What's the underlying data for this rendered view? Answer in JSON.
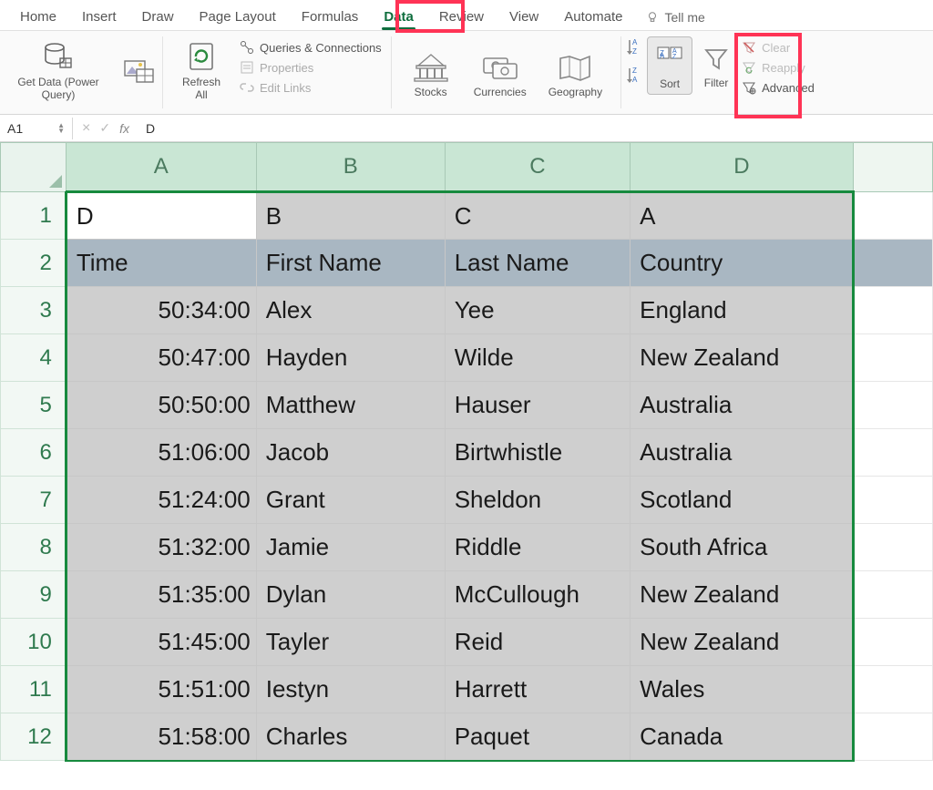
{
  "ribbon": {
    "tabs": [
      "Home",
      "Insert",
      "Draw",
      "Page Layout",
      "Formulas",
      "Data",
      "Review",
      "View",
      "Automate"
    ],
    "active_index": 5,
    "tellme": "Tell me",
    "groups": {
      "get_data": "Get Data (Power Query)",
      "refresh_all": "Refresh All",
      "queries": "Queries & Connections",
      "properties": "Properties",
      "edit_links": "Edit Links",
      "stocks": "Stocks",
      "currencies": "Currencies",
      "geography": "Geography",
      "sort": "Sort",
      "filter": "Filter",
      "clear": "Clear",
      "reapply": "Reapply",
      "advanced": "Advanced"
    }
  },
  "formula_bar": {
    "name_box": "A1",
    "fx_label": "fx",
    "value": "D"
  },
  "grid": {
    "col_labels": [
      "A",
      "B",
      "C",
      "D"
    ],
    "row_labels": [
      "1",
      "2",
      "3",
      "4",
      "5",
      "6",
      "7",
      "8",
      "9",
      "10",
      "11",
      "12"
    ],
    "row1": [
      "D",
      "B",
      "C",
      "A"
    ],
    "headers": [
      "Time",
      "First Name",
      "Last Name",
      "Country"
    ],
    "rows": [
      {
        "time": "50:34:00",
        "first": "Alex",
        "last": "Yee",
        "country": "England"
      },
      {
        "time": "50:47:00",
        "first": "Hayden",
        "last": "Wilde",
        "country": "New Zealand"
      },
      {
        "time": "50:50:00",
        "first": "Matthew",
        "last": "Hauser",
        "country": "Australia"
      },
      {
        "time": "51:06:00",
        "first": "Jacob",
        "last": "Birtwhistle",
        "country": "Australia"
      },
      {
        "time": "51:24:00",
        "first": "Grant",
        "last": "Sheldon",
        "country": "Scotland"
      },
      {
        "time": "51:32:00",
        "first": "Jamie",
        "last": "Riddle",
        "country": "South Africa"
      },
      {
        "time": "51:35:00",
        "first": "Dylan",
        "last": "McCullough",
        "country": "New Zealand"
      },
      {
        "time": "51:45:00",
        "first": "Tayler",
        "last": "Reid",
        "country": "New Zealand"
      },
      {
        "time": "51:51:00",
        "first": "Iestyn",
        "last": "Harrett",
        "country": "Wales"
      },
      {
        "time": "51:58:00",
        "first": "Charles",
        "last": "Paquet",
        "country": "Canada"
      }
    ]
  }
}
